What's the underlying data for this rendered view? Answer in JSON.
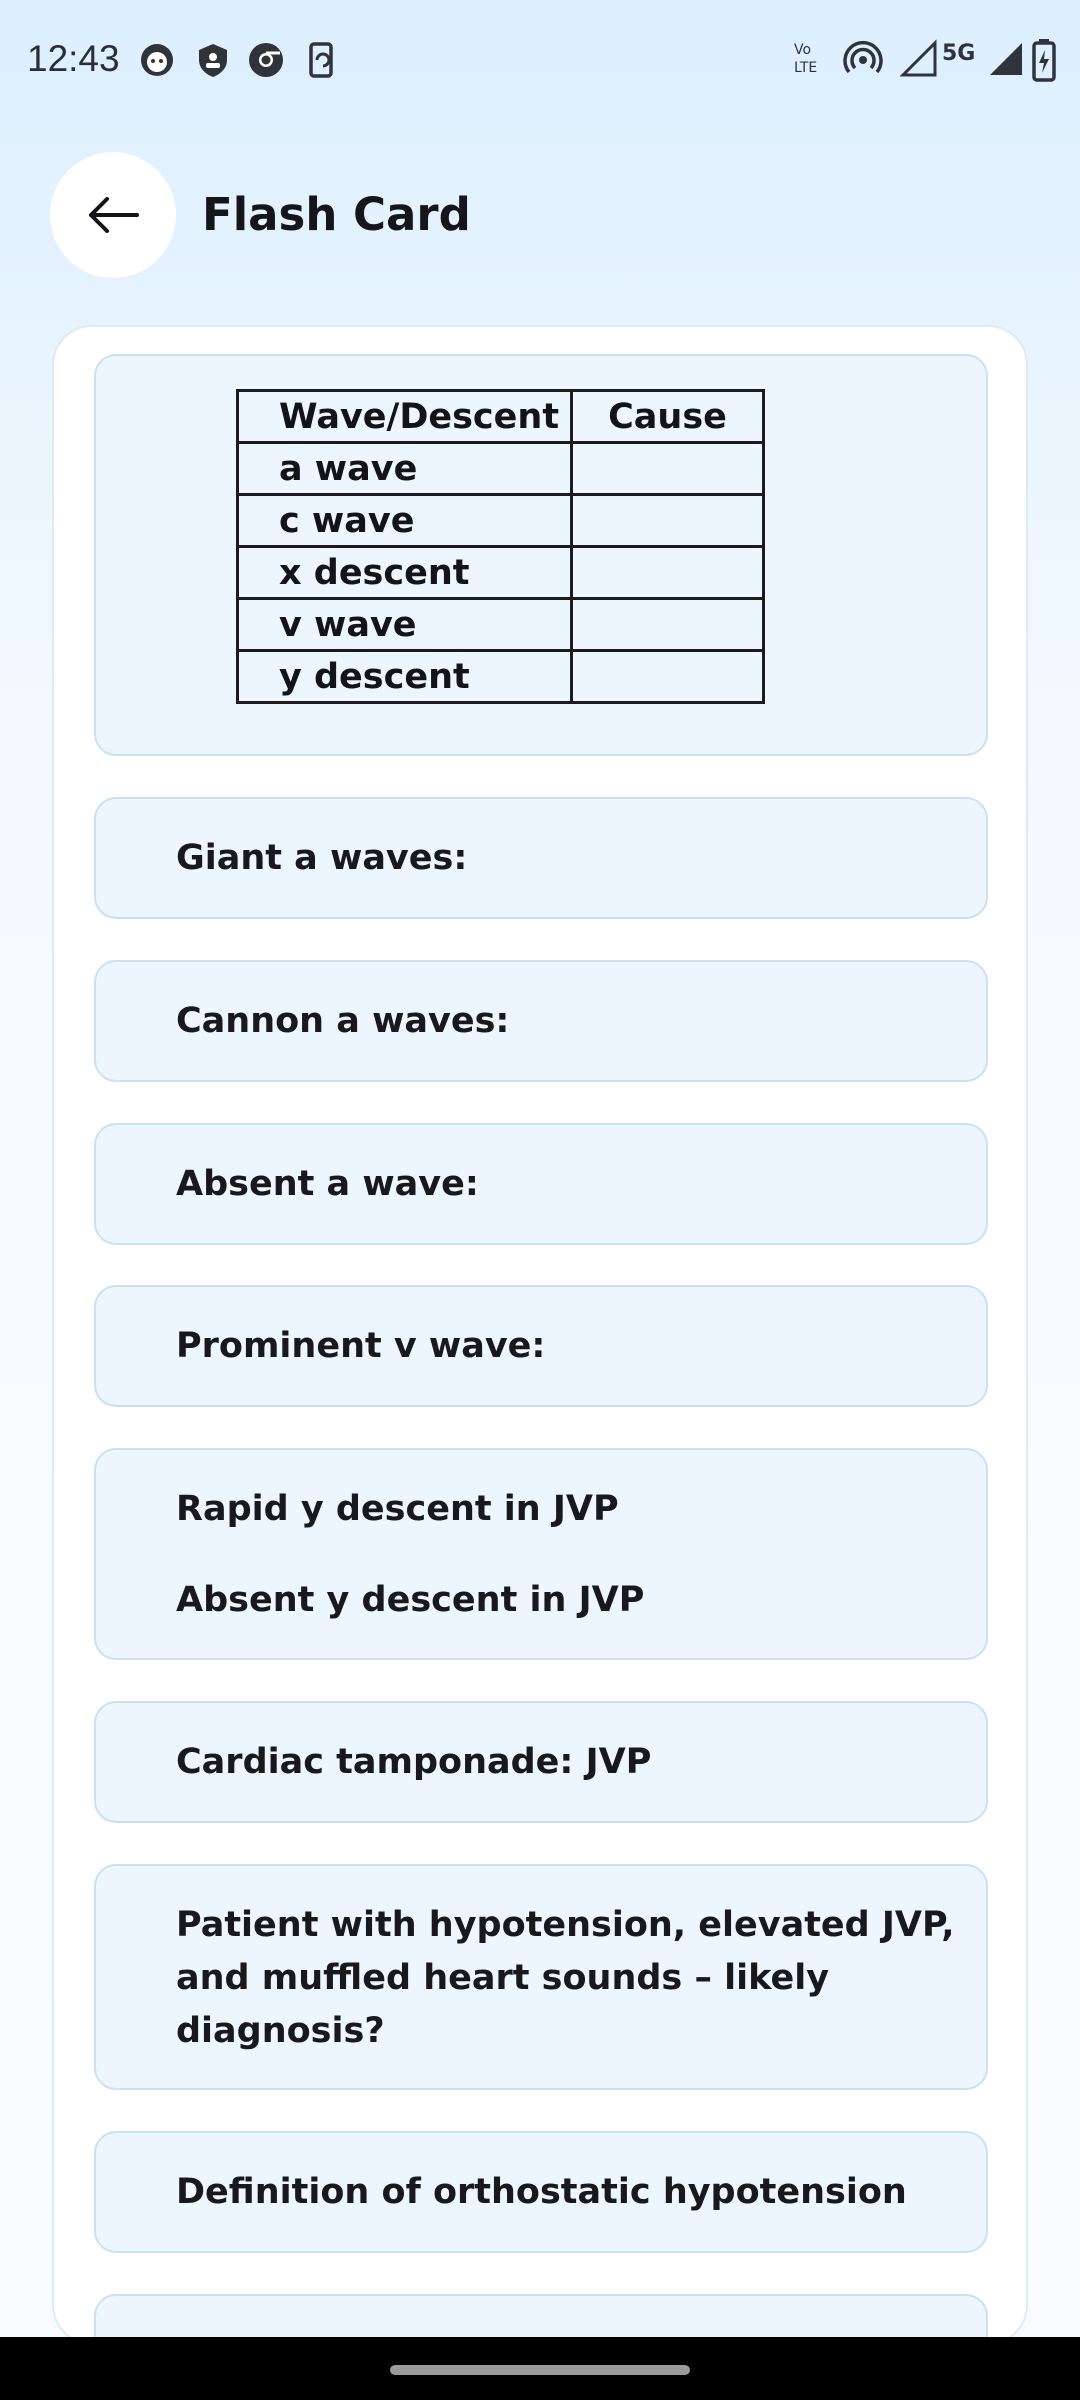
{
  "status_bar": {
    "time": "12:43",
    "volte_top": "Vo",
    "volte_bottom": "LTE",
    "network": "5G",
    "icons_left": [
      "smiley-icon",
      "shield-icon",
      "chrome-icon",
      "screen-rotate-icon"
    ],
    "icons_right": [
      "volte-icon",
      "hotspot-icon",
      "signal-icon",
      "5g-signal-icon",
      "battery-charging-icon"
    ]
  },
  "header": {
    "title": "Flash Card",
    "back_icon": "arrow-left-icon"
  },
  "table": {
    "headers": [
      "Wave/Descent",
      "Cause"
    ],
    "rows": [
      [
        "a wave",
        ""
      ],
      [
        "c wave",
        ""
      ],
      [
        "x descent",
        ""
      ],
      [
        "v wave",
        ""
      ],
      [
        "y descent",
        ""
      ]
    ]
  },
  "cards": [
    {
      "lines": [
        "Giant a waves:"
      ]
    },
    {
      "lines": [
        "Cannon a waves:"
      ]
    },
    {
      "lines": [
        "Absent a wave:"
      ]
    },
    {
      "lines": [
        "Prominent v wave:"
      ]
    },
    {
      "lines": [
        "Rapid y descent in JVP",
        "Absent y descent in JVP"
      ]
    },
    {
      "lines": [
        "Cardiac tamponade: JVP"
      ]
    },
    {
      "lines": [
        "Patient with hypotension, elevated JVP,",
        "and muffled heart sounds – likely",
        "diagnosis?"
      ]
    },
    {
      "lines": [
        "Definition of orthostatic hypotension"
      ]
    }
  ]
}
